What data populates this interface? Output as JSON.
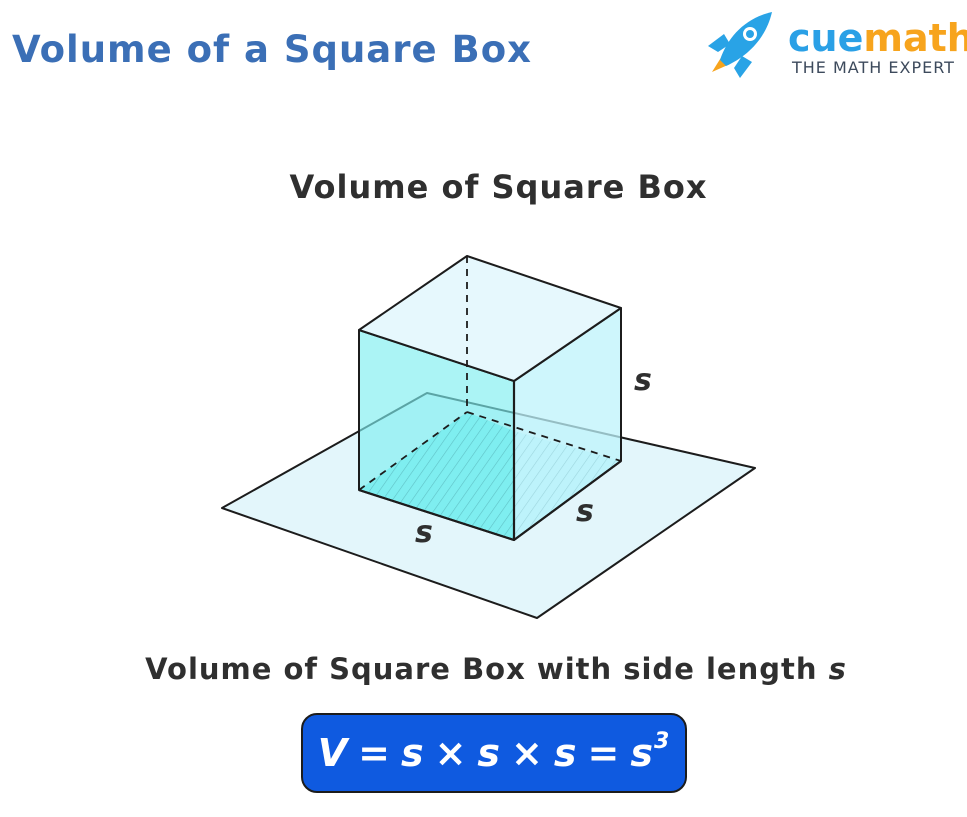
{
  "page": {
    "title": "Volume of a Square Box"
  },
  "logo": {
    "brand_part1": "cue",
    "brand_part2": "math",
    "tagline": "THE MATH EXPERT",
    "icon": "rocket-icon",
    "colors": {
      "cue": "#2aa0e6",
      "math": "#f7a41d",
      "rocket_body": "#29a3e6",
      "rocket_flame": "#f7a41d"
    }
  },
  "diagram": {
    "title": "Volume of Square Box",
    "labels": {
      "height": "s",
      "depth": "s",
      "width": "s"
    },
    "colors": {
      "front_face": "#7eeef0",
      "side_face": "#bdf3fb",
      "top_face": "#e6f8fd",
      "plane": "#e3f6fb",
      "outline": "#1c1c1c"
    }
  },
  "caption": {
    "text": "Volume of Square Box with side length ",
    "variable": "s"
  },
  "formula": {
    "lhs": "V",
    "eq": "=",
    "term": "s",
    "times": "×",
    "exponent": "3",
    "box_color": "#0f5ae0"
  }
}
